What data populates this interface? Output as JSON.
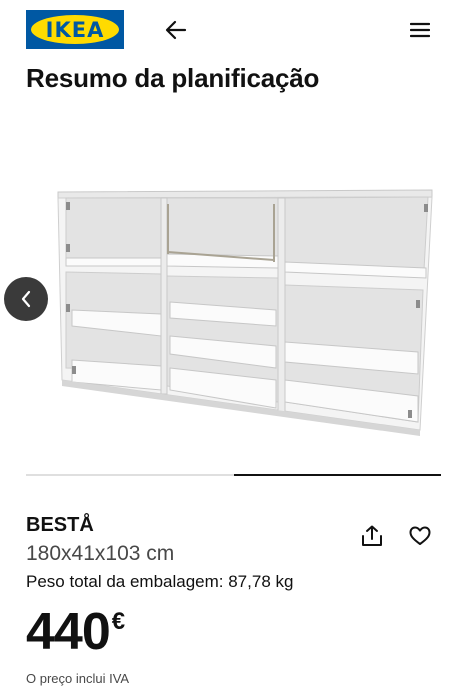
{
  "header": {
    "logo_text": "IKEA",
    "back_icon": "arrow-left-icon",
    "menu_icon": "hamburger-menu-icon"
  },
  "page": {
    "title": "Resumo da planificação"
  },
  "gallery": {
    "prev_icon": "chevron-left-icon",
    "image_alt": "BESTÅ shelving unit, white",
    "progress": {
      "start": 0.5,
      "end": 1.0
    }
  },
  "product": {
    "name": "BESTÅ",
    "dimensions": "180x41x103 cm",
    "weight": "Peso total da embalagem: 87,78 kg",
    "price_int": "440",
    "price_currency": "€",
    "vat_note": "O preço inclui IVA",
    "share_icon": "share-icon",
    "favorite_icon": "heart-icon"
  },
  "colors": {
    "brand_blue": "#0058a3",
    "brand_yellow": "#ffdb00",
    "text": "#111111",
    "muted": "#484848"
  }
}
